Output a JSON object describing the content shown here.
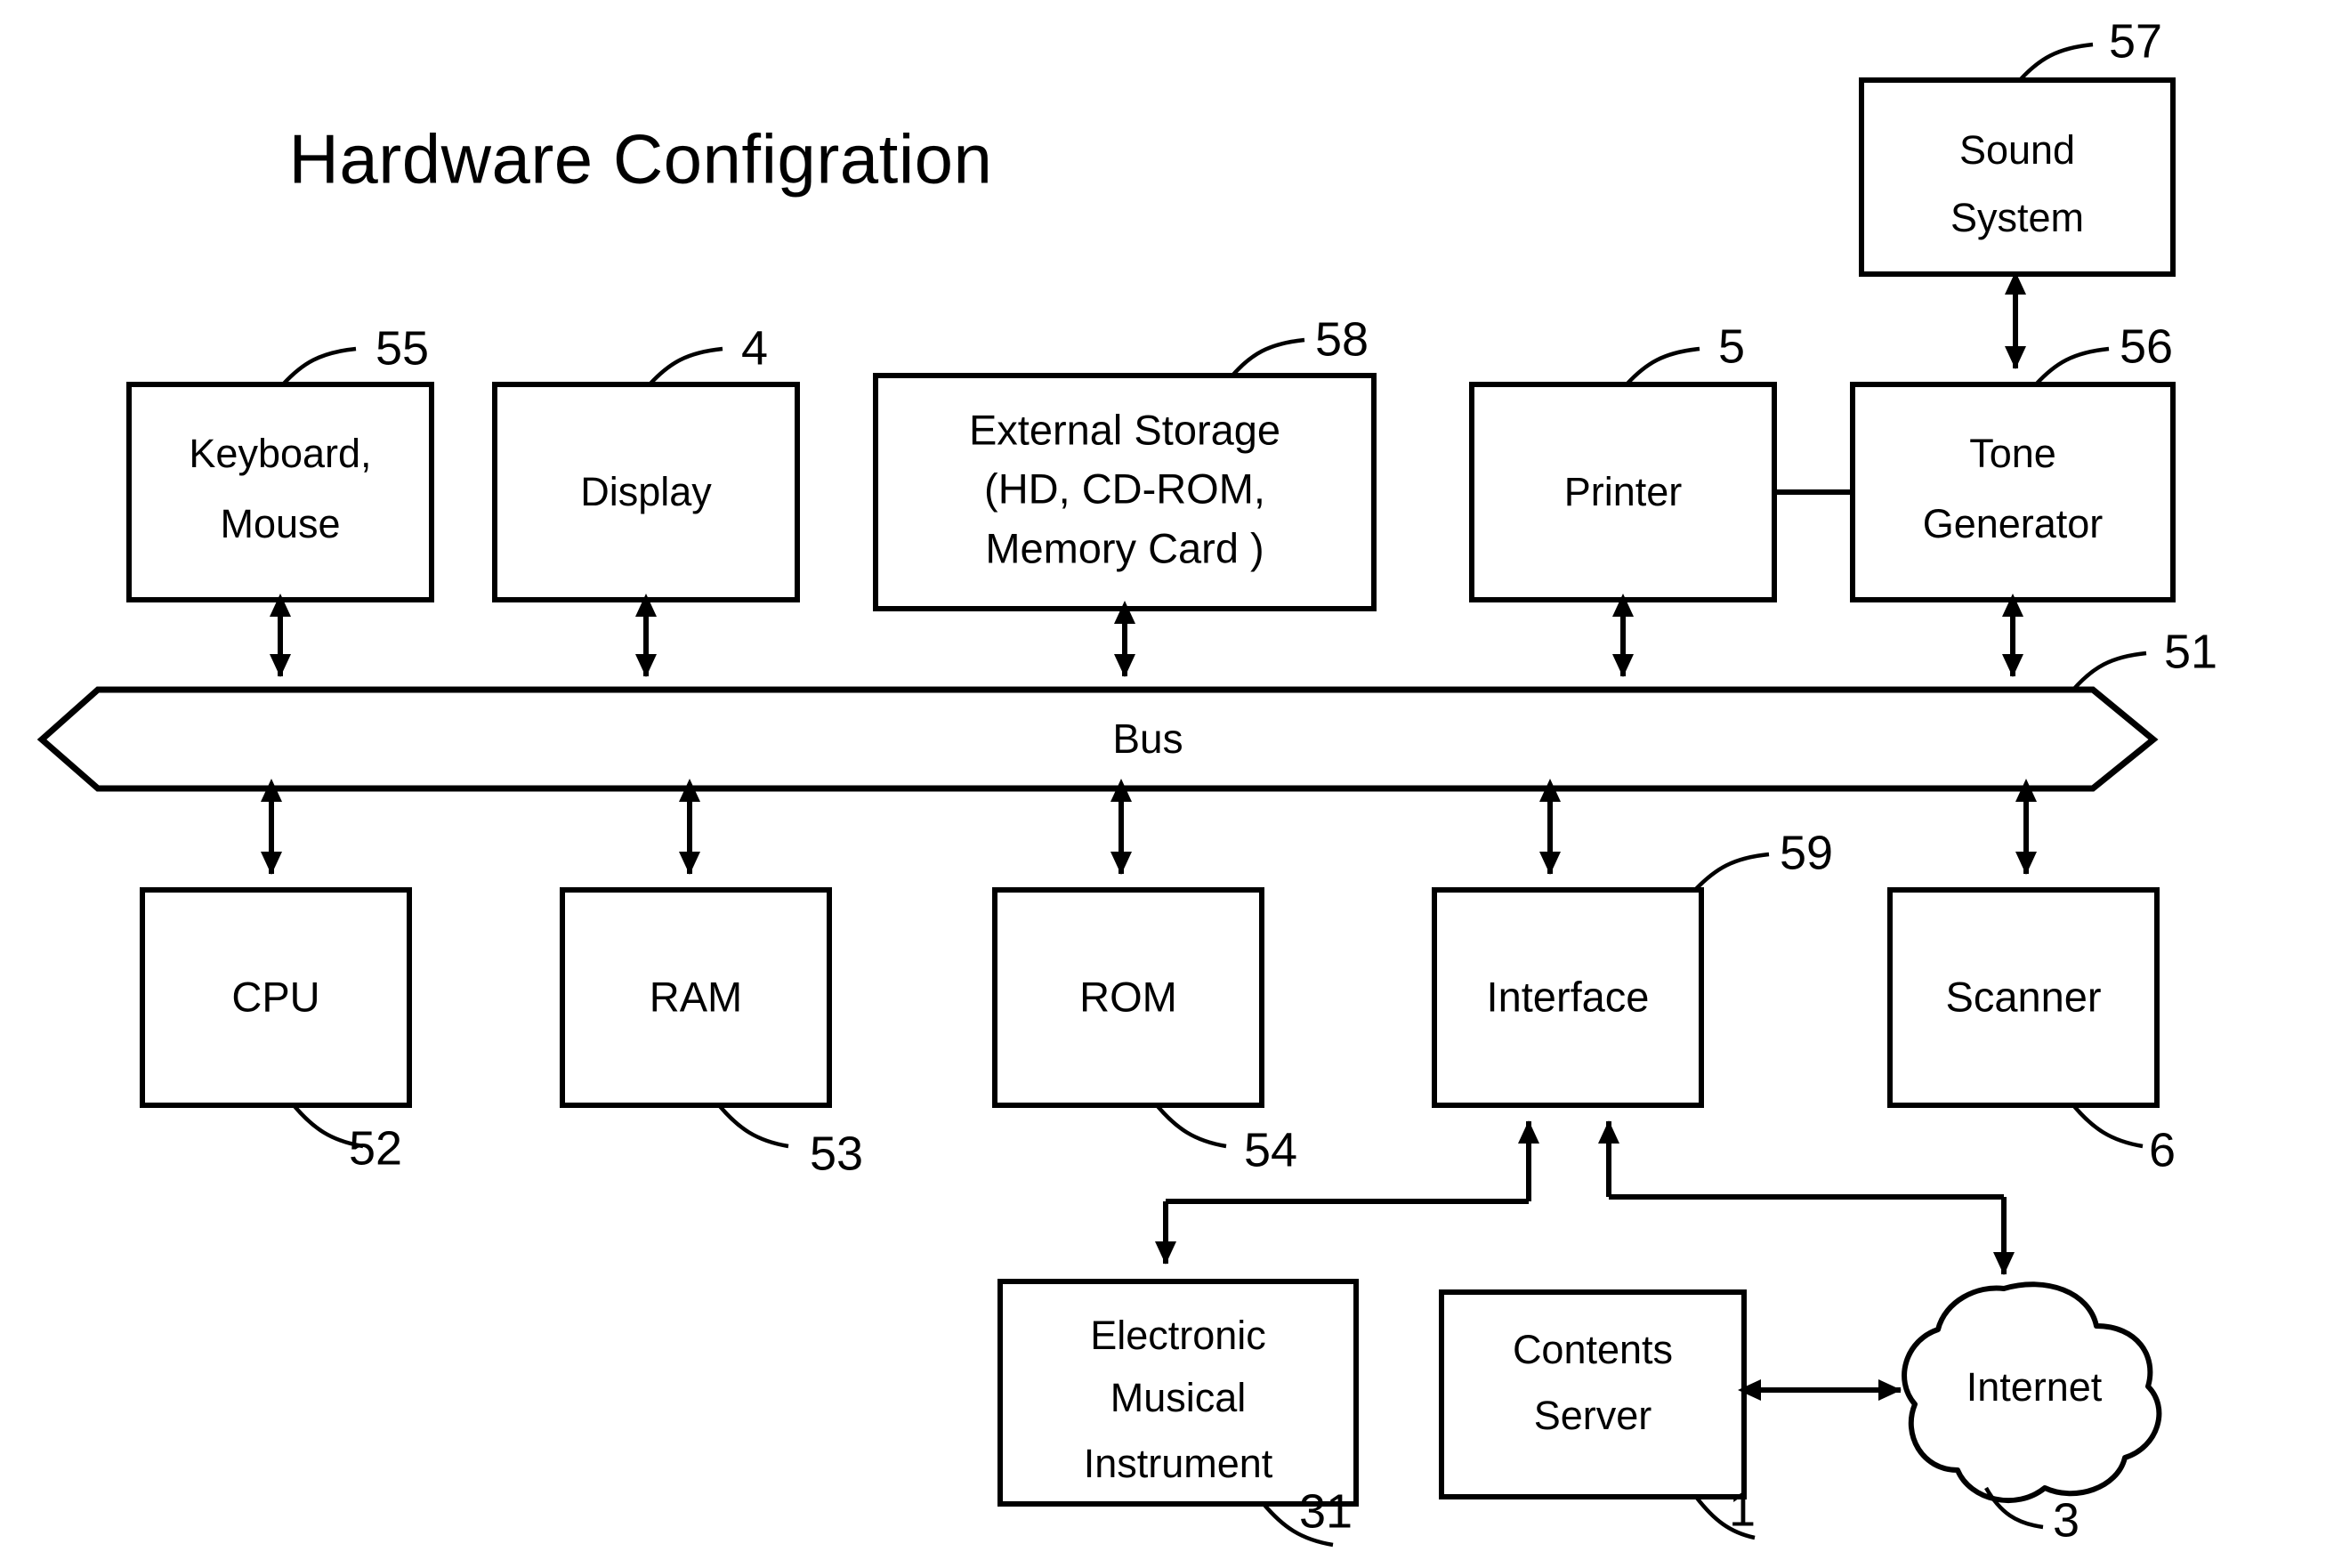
{
  "figure": {
    "title": "Hardware Configration"
  },
  "boxes": {
    "keyboard_mouse": {
      "line1": "Keyboard,",
      "line2": "Mouse",
      "ref": "55"
    },
    "display": {
      "line1": "Display",
      "ref": "4"
    },
    "external_storage": {
      "line1": "External Storage",
      "line2": "(HD, CD-ROM,",
      "line3": "Memory Card )",
      "ref": "58"
    },
    "printer": {
      "line1": "Printer",
      "ref": "5"
    },
    "tone_generator": {
      "line1": "Tone",
      "line2": "Generator",
      "ref": "56"
    },
    "sound_system": {
      "line1": "Sound",
      "line2": "System",
      "ref": "57"
    },
    "bus": {
      "label": "Bus",
      "ref": "51"
    },
    "cpu": {
      "line1": "CPU",
      "ref": "52"
    },
    "ram": {
      "line1": "RAM",
      "ref": "53"
    },
    "rom": {
      "line1": "ROM",
      "ref": "54"
    },
    "interface": {
      "line1": "Interface",
      "ref": "59"
    },
    "scanner": {
      "line1": "Scanner",
      "ref": "6"
    },
    "electronic_musical_instrument": {
      "line1": "Electronic",
      "line2": "Musical",
      "line3": "Instrument",
      "ref": "31"
    },
    "contents_server": {
      "line1": "Contents",
      "line2": "Server",
      "ref": "1"
    },
    "internet": {
      "label": "Internet",
      "ref": "3"
    }
  },
  "colors": {
    "stroke": "#000000",
    "background": "#ffffff"
  }
}
